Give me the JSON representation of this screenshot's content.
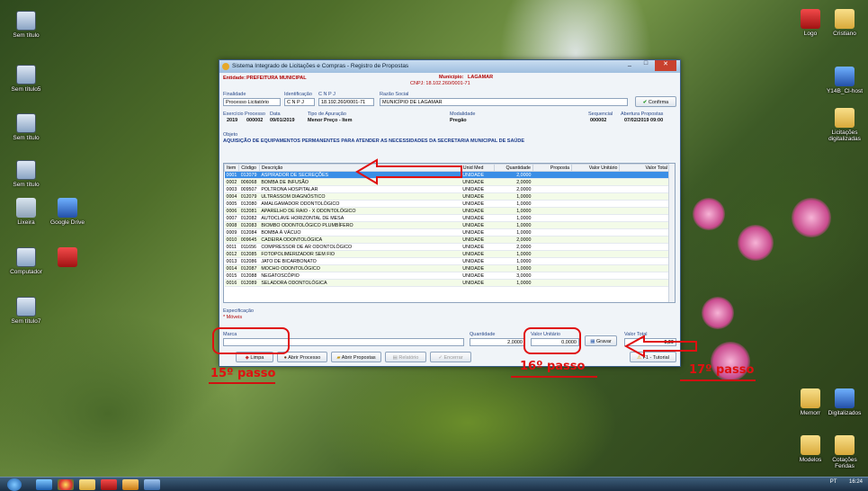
{
  "desktop_icons": [
    {
      "label": "Sem título",
      "glyph": "g-pc"
    },
    {
      "label": "Sem título5",
      "glyph": "g-pc"
    },
    {
      "label": "Sem título",
      "glyph": "g-pc"
    },
    {
      "label": "Sem título",
      "glyph": "g-pc"
    },
    {
      "label": "Lixeira",
      "glyph": "g-trash"
    },
    {
      "label": "Google Drive",
      "glyph": "g-blue"
    },
    {
      "label": "Computador",
      "glyph": "g-pc"
    },
    {
      "label": "Sem título7",
      "glyph": "g-pc"
    },
    {
      "label": "Logo",
      "glyph": "g-red"
    },
    {
      "label": "Cristiano",
      "glyph": "g-folder"
    },
    {
      "label": "Y14B_Cl-host",
      "glyph": "g-blue"
    },
    {
      "label": "Licitações digitalizadas",
      "glyph": "g-folder"
    },
    {
      "label": "Memorr",
      "glyph": "g-folder"
    },
    {
      "label": "Digitalizados",
      "glyph": "g-blue"
    },
    {
      "label": "Modelos",
      "glyph": "g-folder"
    },
    {
      "label": "Cotações Feridas",
      "glyph": "g-folder"
    }
  ],
  "window": {
    "title": "Sistema Integrado de Licitações e Compras - Registro de Propostas",
    "entity_label": "Entidade:",
    "entity_value": "PREFEITURA MUNICIPAL",
    "municipio_label": "Município:",
    "municipio_value": "LAGAMAR",
    "cnpj_header": "CNPJ: 18.102.260/0001-71",
    "finalidade_label": "Finalidade",
    "finalidade_value": "Processo Licitatório",
    "identificacao_label": "Identificação",
    "identificacao_value": "C N P J",
    "cnpj_label": "C N P J",
    "cnpj_value": "18.192.260/0001-71",
    "razao_label": "Razão Social",
    "razao_value": "MUNICÍPIO DE LAGAMAR",
    "confirm_label": "Confirma",
    "exercicio_label": "Exercício",
    "exercicio_value": "2019",
    "processo_label": "Processo",
    "processo_value": "000002",
    "data_label": "Data",
    "data_value": "09/01/2019",
    "apuracao_label": "Tipo de Apuração",
    "apuracao_value": "Menor Preço - Item",
    "modalidade_label": "Modalidade",
    "modalidade_value": "Pregão",
    "sequencial_label": "Sequencial",
    "sequencial_value": "000002",
    "abertura_label": "Abertura Propostas",
    "abertura_value": "07/02/2019 09:00",
    "objeto_label": "Objeto",
    "objeto_value": "AQUISIÇÃO DE EQUIPAMENTOS PERMANENTES PARA ATENDER AS NECESSIDADES DA SECRETARIA MUNICIPAL DE SAÚDE",
    "columns": [
      "Item",
      "Código",
      "Descrição",
      "Unid Med",
      "Quantidade",
      "Proposta",
      "Valor Unitário",
      "Valor Total"
    ],
    "rows": [
      [
        "0001",
        "012079",
        "ASPIRADOR DE SECREÇÕES",
        "UNIDADE",
        "2,0000"
      ],
      [
        "0002",
        "006068",
        "BOMBA DE INFUSÃO",
        "UNIDADE",
        "2,0000"
      ],
      [
        "0003",
        "009507",
        "POLTRONA HOSPITALAR",
        "UNIDADE",
        "2,0000"
      ],
      [
        "0004",
        "012079",
        "ULTRASSOM DIAGNÓSTICO",
        "UNIDADE",
        "1,0000"
      ],
      [
        "0005",
        "012080",
        "AMALGAMADOR ODONTOLÓGICO",
        "UNIDADE",
        "1,0000"
      ],
      [
        "0006",
        "012081",
        "APARELHO DE RAIO - X ODONTOLÓGICO",
        "UNIDADE",
        "1,0000"
      ],
      [
        "0007",
        "012082",
        "AUTOCLAVE HORIZONTAL DE MESA",
        "UNIDADE",
        "1,0000"
      ],
      [
        "0008",
        "012083",
        "BIOMBO ODONTOLÓGICO PLUMBÍFERO",
        "UNIDADE",
        "1,0000"
      ],
      [
        "0009",
        "012084",
        "BOMBA À VÁCUO",
        "UNIDADE",
        "1,0000"
      ],
      [
        "0010",
        "009645",
        "CADEIRA ODONTOLÓGICA",
        "UNIDADE",
        "2,0000"
      ],
      [
        "0011",
        "011656",
        "COMPRESSOR DE AR ODONTOLÓGICO",
        "UNIDADE",
        "2,0000"
      ],
      [
        "0012",
        "012085",
        "FOTOPOLIMERIZADOR SEM FIO",
        "UNIDADE",
        "1,0000"
      ],
      [
        "0013",
        "012086",
        "JATO DE BICARBONATO",
        "UNIDADE",
        "1,0000"
      ],
      [
        "0014",
        "012087",
        "MOCHO ODONTOLÓGICO",
        "UNIDADE",
        "1,0000"
      ],
      [
        "0015",
        "012088",
        "NEGATOSCÓPIO",
        "UNIDADE",
        "3,0000"
      ],
      [
        "0016",
        "012089",
        "SELADORA ODONTOLÓGICA",
        "UNIDADE",
        "1,0000"
      ]
    ],
    "especificacao_label": "Especificação",
    "especificacao_value": "* Móveis",
    "marca_label": "Marca",
    "marca_value": "",
    "quantidade_label": "Quantidade",
    "quantidade_value": "2,0000",
    "valor_unitario_label": "Valor Unitário",
    "valor_unitario_value": "0,0000",
    "valor_total_label": "Valor Total",
    "valor_total_value": "0,00",
    "gravar_label": "Gravar",
    "buttons": [
      "Limpa",
      "Abrir Processo",
      "Abrir Propostas",
      "Relatório",
      "Encerrar"
    ],
    "tutorial_label": "F1 - Tutorial"
  },
  "annotations": {
    "step15": "15º passo",
    "step16": "16º passo",
    "step17": "17º passo"
  },
  "tray": {
    "lang": "PT",
    "time": "16:24"
  }
}
